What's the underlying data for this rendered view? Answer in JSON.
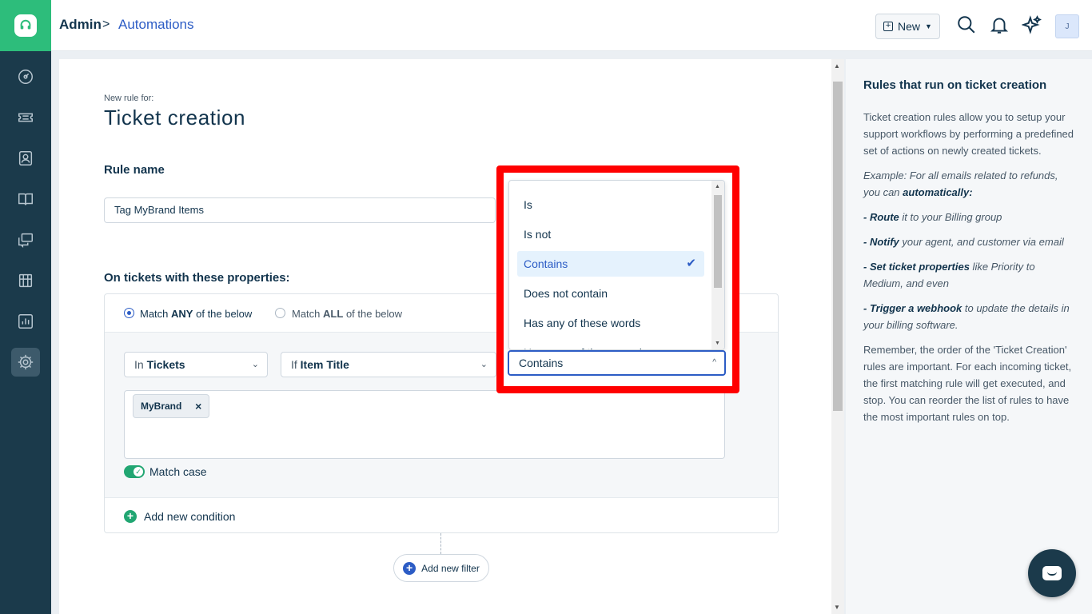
{
  "header": {
    "breadcrumb_admin": "Admin",
    "breadcrumb_sep": ">",
    "breadcrumb_current": "Automations",
    "new_button": "New",
    "avatar_initial": "J"
  },
  "sidebar": {
    "items": [
      "dashboard",
      "tickets",
      "contacts",
      "solutions",
      "forums",
      "groups",
      "analytics",
      "admin"
    ],
    "active": "admin"
  },
  "main": {
    "sub_label": "New rule for:",
    "title": "Ticket creation",
    "rule_name_label": "Rule name",
    "rule_name_value": "Tag MyBrand Items",
    "conditions_label": "On tickets with these properties:",
    "match_any_pre": "Match",
    "match_any_bold": "ANY",
    "match_any_post": "of the below",
    "match_all_pre": "Match",
    "match_all_bold": "ALL",
    "match_all_post": "of the below",
    "match_selected": "any",
    "in_prefix": "In",
    "in_value": "Tickets",
    "if_prefix": "If",
    "if_value": "Item Title",
    "operator_value": "Contains",
    "tag_value": "MyBrand",
    "tag_remove": "×",
    "match_case_label": "Match case",
    "match_case_on": true,
    "add_condition": "Add new condition",
    "add_filter": "Add new filter"
  },
  "dropdown": {
    "options": [
      "Is",
      "Is not",
      "Contains",
      "Does not contain",
      "Has any of these words",
      "Has none of these words"
    ],
    "selected": "Contains",
    "highlight_color": "#ff0000"
  },
  "help": {
    "title": "Rules that run on ticket creation",
    "intro": "Ticket creation rules allow you to setup your support workflows by performing a predefined set of actions on newly created tickets.",
    "example_pre": "Example: For all emails related to refunds, you can ",
    "example_bold": "automatically:",
    "b1_bold": "- Route",
    "b1_rest": " it to your Billing group",
    "b2_bold": "- Notify",
    "b2_rest": " your agent, and customer via email",
    "b3_bold": "- Set ticket properties",
    "b3_rest": " like Priority to Medium, and even",
    "b4_bold": "- Trigger a webhook",
    "b4_rest": " to update the details in your billing software.",
    "outro": "Remember, the order of the 'Ticket Creation' rules are important. For each incoming ticket, the first matching rule will get executed, and stop. You can reorder the list of rules to have the most important rules on top."
  },
  "colors": {
    "brand_green": "#2dbd7b",
    "sidebar": "#1b3a4b",
    "accent_blue": "#2c5cc5"
  }
}
